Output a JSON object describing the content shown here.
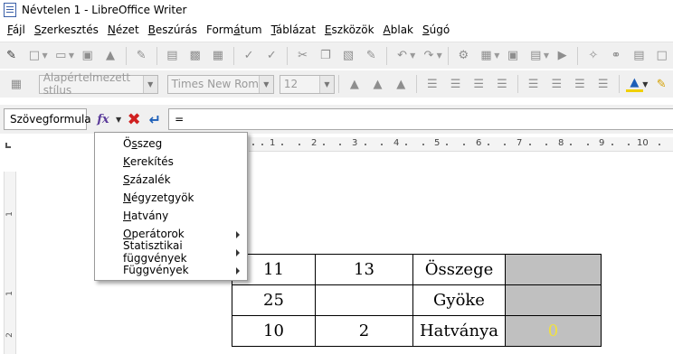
{
  "window": {
    "title": "Névtelen 1 - LibreOffice Writer"
  },
  "menubar": {
    "items": [
      {
        "pre": "",
        "accel": "F",
        "post": "ájl"
      },
      {
        "pre": "",
        "accel": "S",
        "post": "zerkesztés"
      },
      {
        "pre": "",
        "accel": "N",
        "post": "ézet"
      },
      {
        "pre": "",
        "accel": "B",
        "post": "eszúrás"
      },
      {
        "pre": "Form",
        "accel": "á",
        "post": "tum"
      },
      {
        "pre": "",
        "accel": "T",
        "post": "áblázat"
      },
      {
        "pre": "",
        "accel": "E",
        "post": "szközök"
      },
      {
        "pre": "",
        "accel": "A",
        "post": "blak"
      },
      {
        "pre": "",
        "accel": "S",
        "post": "úgó"
      }
    ]
  },
  "formatting": {
    "paragraph_style": "Alapértelmezett stílus",
    "font_name": "Times New Roman",
    "font_size": "12"
  },
  "formula_bar": {
    "name_box": "Szövegformula",
    "formula": "="
  },
  "formula_menu": {
    "items": [
      {
        "pre": "Ö",
        "accel": "s",
        "post": "szeg",
        "submenu": false
      },
      {
        "pre": "",
        "accel": "K",
        "post": "erekítés",
        "submenu": false
      },
      {
        "pre": "",
        "accel": "S",
        "post": "zázalék",
        "submenu": false
      },
      {
        "pre": "",
        "accel": "N",
        "post": "égyzetgyök",
        "submenu": false
      },
      {
        "pre": "",
        "accel": "H",
        "post": "atvány",
        "submenu": false
      },
      {
        "pre": "",
        "accel": "O",
        "post": "perátorok",
        "submenu": true
      },
      {
        "pre": "Statisztikai függvények",
        "accel": "",
        "post": "",
        "submenu": true
      },
      {
        "pre": "Függvények",
        "accel": "",
        "post": "",
        "submenu": true
      }
    ]
  },
  "ruler": {
    "horizontal_marks": [
      "1",
      "2",
      "3",
      "4",
      "5",
      "6",
      "7",
      "8",
      "9",
      "10"
    ],
    "vertical_marks": [
      "1",
      "1",
      "2"
    ]
  },
  "table": {
    "rows": [
      [
        "11",
        "13",
        "Összege",
        ""
      ],
      [
        "25",
        "",
        "Gyöke",
        ""
      ],
      [
        "10",
        "2",
        "Hatványa",
        "0"
      ]
    ]
  },
  "icons": [
    "app-icon",
    "fx-icon",
    "cancel-icon",
    "accept-icon"
  ],
  "colors": {
    "accent_blue": "#1d5fb8",
    "cancel_red": "#d02020",
    "cell_gray": "#c0c0c0",
    "result_yellow": "#f0e040"
  }
}
